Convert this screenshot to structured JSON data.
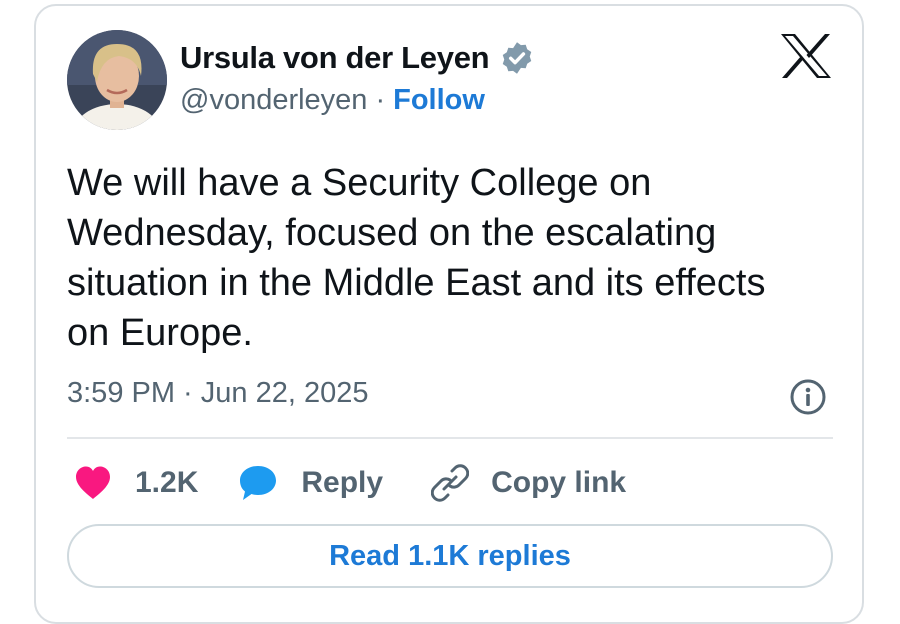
{
  "author": {
    "name": "Ursula von der Leyen",
    "handle": "@vonderleyen",
    "separator": "·",
    "follow_label": "Follow",
    "verified_icon": "verified-badge-icon"
  },
  "tweet": {
    "text": "We will have a Security College on\nWednesday, focused on the escalating\nsituation in the Middle East and its effects\non Europe.",
    "timestamp": "3:59 PM · Jun 22, 2025"
  },
  "actions": {
    "like_count": "1.2K",
    "reply_label": "Reply",
    "copy_link_label": "Copy link"
  },
  "read_replies_label": "Read 1.1K replies",
  "colors": {
    "heart": "#f91880",
    "reply_bubble": "#1d9bf0",
    "link_blue": "#1d7ad6",
    "muted_text": "#536471",
    "verified_badge": "#829aab"
  },
  "icons": [
    "x-logo-icon",
    "info-icon",
    "heart-icon",
    "reply-bubble-icon",
    "link-icon"
  ]
}
